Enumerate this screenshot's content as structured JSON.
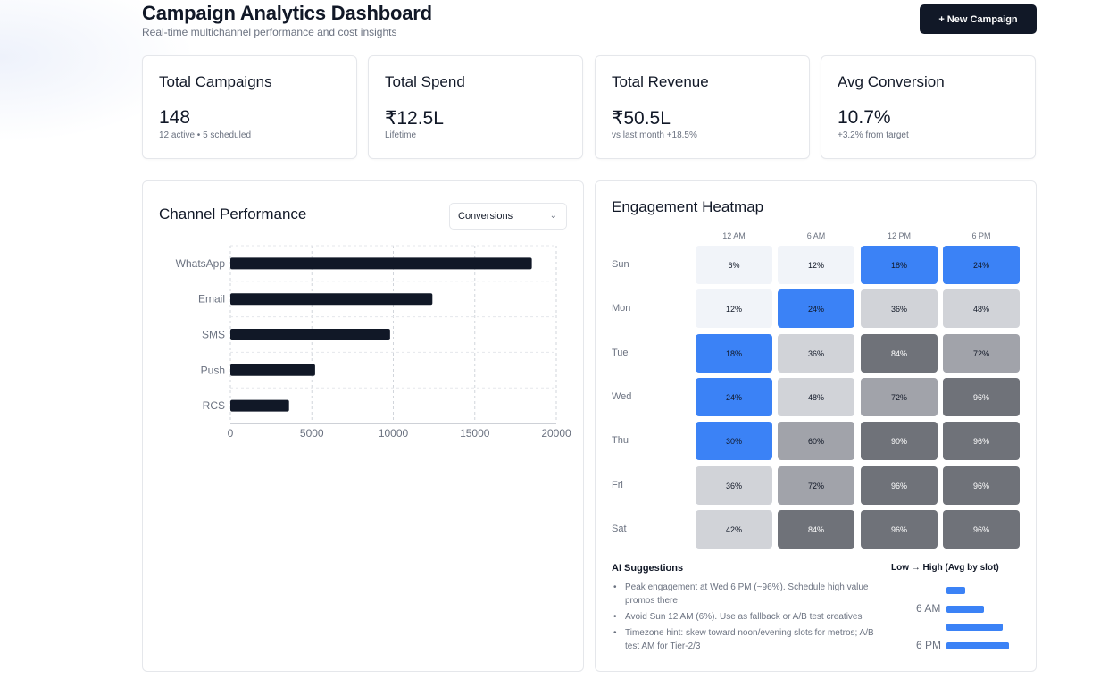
{
  "header": {
    "title": "Campaign Analytics Dashboard",
    "subtitle": "Real-time multichannel performance and cost insights",
    "new_button": "+ New Campaign"
  },
  "stats": [
    {
      "label": "Total Campaigns",
      "value": "148",
      "sub": "12 active • 5 scheduled"
    },
    {
      "label": "Total Spend",
      "value": "₹12.5L",
      "sub": "Lifetime"
    },
    {
      "label": "Total Revenue",
      "value": "₹50.5L",
      "sub": "vs last month +18.5%"
    },
    {
      "label": "Avg Conversion",
      "value": "10.7%",
      "sub": "+3.2% from target"
    }
  ],
  "channel_panel": {
    "title": "Channel Performance",
    "metric_select": "Conversions",
    "chevron_icon": "chevron-down-icon"
  },
  "chart_data": {
    "type": "bar",
    "orientation": "horizontal",
    "categories": [
      "WhatsApp",
      "Email",
      "SMS",
      "Push",
      "RCS"
    ],
    "values": [
      18500,
      12400,
      9800,
      5200,
      3600
    ],
    "xlim": [
      0,
      20000
    ],
    "xticks": [
      "0",
      "5000",
      "10000",
      "15000",
      "20000"
    ],
    "grid": true,
    "bar_color": "#111827"
  },
  "heatmap_panel": {
    "title": "Engagement Heatmap",
    "columns": [
      "12 AM",
      "6 AM",
      "12 PM",
      "6 PM"
    ],
    "rows": [
      {
        "day": "Sun",
        "cells": [
          "6%",
          "12%",
          "18%",
          "24%"
        ]
      },
      {
        "day": "Mon",
        "cells": [
          "12%",
          "24%",
          "36%",
          "48%"
        ]
      },
      {
        "day": "Tue",
        "cells": [
          "18%",
          "36%",
          "84%",
          "72%"
        ]
      },
      {
        "day": "Wed",
        "cells": [
          "24%",
          "48%",
          "72%",
          "96%"
        ]
      },
      {
        "day": "Thu",
        "cells": [
          "30%",
          "60%",
          "90%",
          "96%"
        ]
      },
      {
        "day": "Fri",
        "cells": [
          "36%",
          "72%",
          "96%",
          "96%"
        ]
      },
      {
        "day": "Sat",
        "cells": [
          "42%",
          "84%",
          "96%",
          "96%"
        ]
      }
    ],
    "colors": {
      "low": "#f1f4f9",
      "blue": "#3b82f6",
      "light_gray": "#d1d3d8",
      "mid_gray": "#a1a3aa",
      "dark_gray": "#6f7279"
    },
    "ai_title": "AI Suggestions",
    "suggestions": [
      "Peak engagement at Wed 6 PM (~96%). Schedule high value promos there",
      "Avoid Sun 12 AM (6%). Use as fallback or A/B test creatives",
      "Timezone hint: skew toward noon/evening slots for metros; A/B test AM for Tier-2/3"
    ],
    "legend_title": "Low → High (Avg by slot)",
    "legend_slots": [
      {
        "label": "",
        "value": 18
      },
      {
        "label": "6 AM",
        "value": 36
      },
      {
        "label": "",
        "value": 54
      },
      {
        "label": "6 PM",
        "value": 60
      }
    ]
  }
}
